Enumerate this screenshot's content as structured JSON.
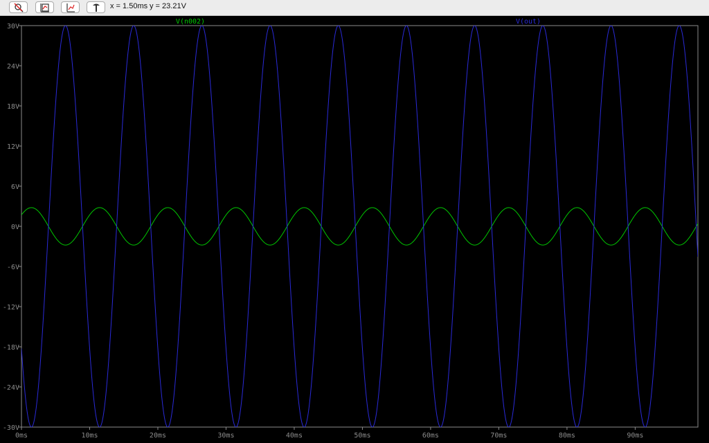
{
  "toolbar": {
    "buttons": [
      {
        "icon": "zoom-cancel-icon"
      },
      {
        "icon": "autorange-icon"
      },
      {
        "icon": "zoom-fit-icon"
      },
      {
        "icon": "probe-icon"
      }
    ],
    "cursor_x": "x = 1.50ms",
    "cursor_y": "y = 23.21V"
  },
  "chart_data": {
    "type": "line",
    "background": "#000000",
    "axis_color": "#8c8c8c",
    "x_unit": "ms",
    "xlim": [
      0,
      99.2
    ],
    "ylim": [
      -30,
      30
    ],
    "x_ticks": [
      0,
      10,
      20,
      30,
      40,
      50,
      60,
      70,
      80,
      90
    ],
    "x_tick_labels": [
      "0ms",
      "10ms",
      "20ms",
      "30ms",
      "40ms",
      "50ms",
      "60ms",
      "70ms",
      "80ms",
      "90ms"
    ],
    "y_ticks": [
      30,
      24,
      18,
      12,
      6,
      0,
      -6,
      -12,
      -18,
      -24,
      -30
    ],
    "y_tick_labels": [
      "30V",
      "24V",
      "18V",
      "12V",
      "6V",
      "0V",
      "-6V",
      "-12V",
      "-18V",
      "-24V",
      "-30V"
    ],
    "series": [
      {
        "name": "V(n002)",
        "color": "#00c800",
        "waveform": "sine",
        "amplitude": 2.8,
        "frequency_hz": 100,
        "phase_deg": 37.5,
        "offset": 0
      },
      {
        "name": "V(out)",
        "color": "#2a2ad8",
        "waveform": "sine",
        "amplitude": 30,
        "frequency_hz": 100,
        "phase_deg": -142.5,
        "offset": 0
      }
    ]
  }
}
